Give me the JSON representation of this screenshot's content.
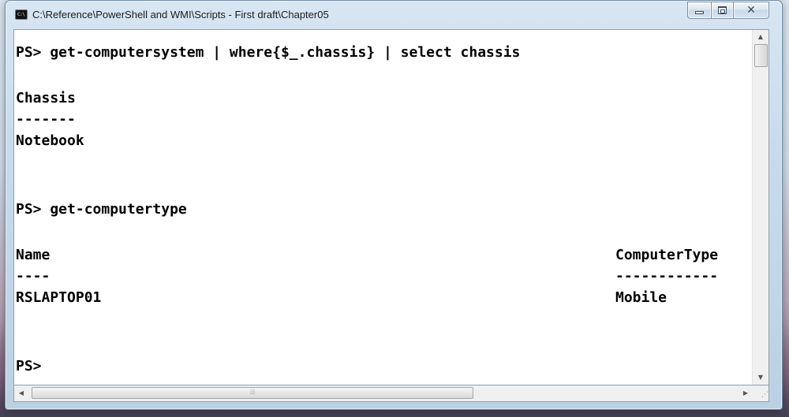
{
  "window": {
    "title": "C:\\Reference\\PowerShell and WMI\\Scripts - First draft\\Chapter05",
    "icon_label": "C:\\",
    "buttons": {
      "minimize": "minimize",
      "maximize": "maximize",
      "close": "✕"
    }
  },
  "console": {
    "lines": [
      {
        "text": "PS> get-computersystem | where{$_.chassis} | select chassis",
        "col2": ""
      },
      {
        "text": "",
        "col2": ""
      },
      {
        "text": "Chassis",
        "col2": ""
      },
      {
        "text": "-------",
        "col2": ""
      },
      {
        "text": "Notebook",
        "col2": ""
      },
      {
        "text": "",
        "col2": ""
      },
      {
        "text": "",
        "col2": ""
      },
      {
        "text": "PS> get-computertype",
        "col2": ""
      },
      {
        "text": "",
        "col2": ""
      },
      {
        "text": "Name",
        "col2": "ComputerType"
      },
      {
        "text": "----",
        "col2": "------------"
      },
      {
        "text": "RSLAPTOP01",
        "col2": "Mobile"
      },
      {
        "text": "",
        "col2": ""
      },
      {
        "text": "",
        "col2": ""
      },
      {
        "text": "PS>",
        "col2": ""
      }
    ]
  },
  "scrollbars": {
    "vertical": {
      "up_arrow": "▲",
      "down_arrow": "▼",
      "position": 0
    },
    "horizontal": {
      "left_arrow": "◀",
      "right_arrow": "▶",
      "grip": "⦙⦙⦙",
      "position": 0
    }
  },
  "icons": {
    "window_icon": "console-icon",
    "size_grip": "size-grip-icon"
  }
}
